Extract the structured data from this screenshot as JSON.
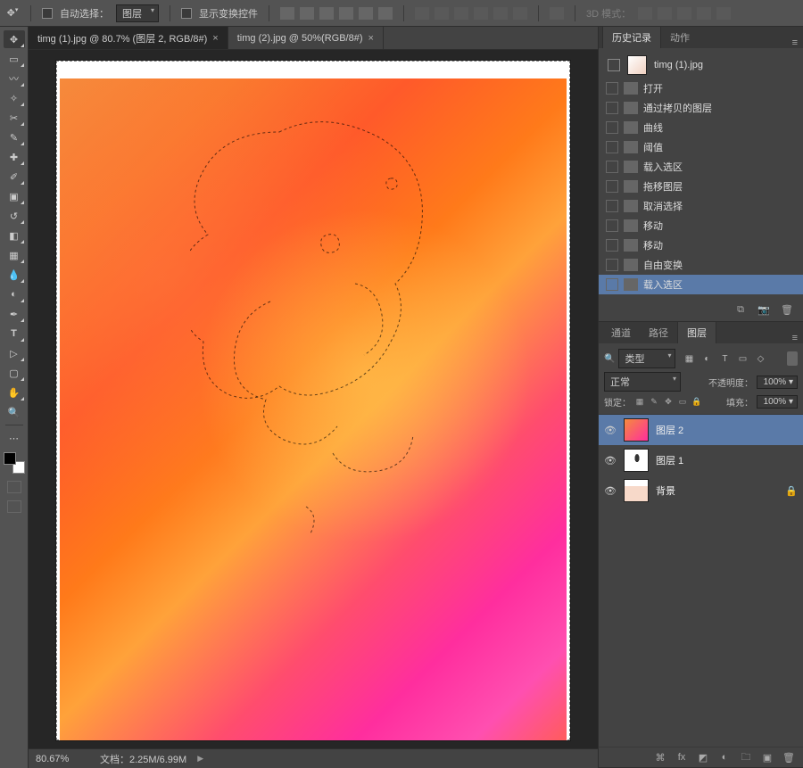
{
  "options_bar": {
    "auto_select_label": "自动选择：",
    "auto_select_target": "图层",
    "show_transform_label": "显示变换控件",
    "mode_3d_label": "3D 模式："
  },
  "tabs": [
    {
      "title": "timg (1).jpg @ 80.7% (图层 2, RGB/8#)",
      "active": true
    },
    {
      "title": "timg (2).jpg @ 50%(RGB/8#)",
      "active": false
    }
  ],
  "status": {
    "zoom": "80.67%",
    "doc_label": "文档：",
    "doc_value": "2.25M/6.99M"
  },
  "history_panel": {
    "tab_history": "历史记录",
    "tab_actions": "动作",
    "source_file": "timg (1).jpg",
    "items": [
      "打开",
      "通过拷贝的图层",
      "曲线",
      "阈值",
      "载入选区",
      "拖移图层",
      "取消选择",
      "移动",
      "移动",
      "自由变换",
      "载入选区"
    ],
    "selected_index": 10
  },
  "right_panel_tabs": {
    "channels": "通道",
    "paths": "路径",
    "layers": "图层"
  },
  "layers_panel": {
    "kind_label": "类型",
    "blend_mode": "正常",
    "opacity_label": "不透明度：",
    "opacity_value": "100%",
    "lock_label": "锁定：",
    "fill_label": "填充：",
    "fill_value": "100%",
    "layers": [
      {
        "name": "图层 2",
        "thumb": "t1",
        "locked": false,
        "selected": true
      },
      {
        "name": "图层 1",
        "thumb": "t2",
        "locked": false,
        "selected": false
      },
      {
        "name": "背景",
        "thumb": "t3",
        "locked": true,
        "selected": false
      }
    ]
  },
  "glyphs": {
    "search": "🔍",
    "eye": "👁",
    "lock": "🔒",
    "trash": "🗑",
    "camera": "📷",
    "new": "⧉"
  }
}
